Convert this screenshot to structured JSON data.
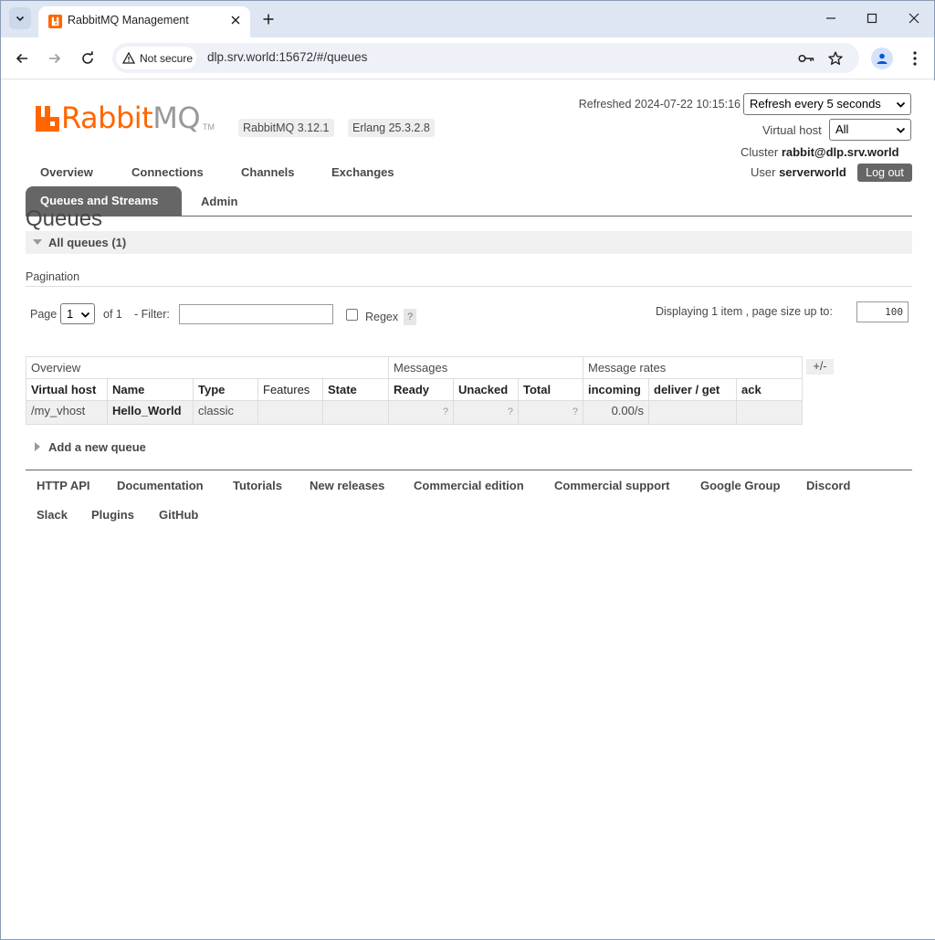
{
  "browser": {
    "tab_title": "RabbitMQ Management",
    "security_label": "Not secure",
    "url": "dlp.srv.world:15672/#/queues"
  },
  "header": {
    "logo_rabbit": "Rabbit",
    "logo_mq": "MQ",
    "logo_tm": "TM",
    "rabbitmq_version": "RabbitMQ 3.12.1",
    "erlang_version": "Erlang 25.3.2.8",
    "refreshed": "Refreshed 2024-07-22 10:15:16",
    "refresh_select": "Refresh every 5 seconds",
    "vhost_label": "Virtual host",
    "vhost_value": "All",
    "cluster_label": "Cluster",
    "cluster_value": "rabbit@dlp.srv.world",
    "user_label": "User",
    "user_value": "serverworld",
    "logout": "Log out"
  },
  "nav": {
    "overview": "Overview",
    "connections": "Connections",
    "channels": "Channels",
    "exchanges": "Exchanges",
    "queues": "Queues and Streams",
    "admin": "Admin"
  },
  "main": {
    "title": "Queues",
    "all_queues": "All queues (1)",
    "pagination_title": "Pagination",
    "page_label": "Page",
    "page_value": "1",
    "of_label": "of 1",
    "filter_label": "- Filter:",
    "regex_label": "Regex",
    "help": "?",
    "displaying": "Displaying 1 item , page size up to:",
    "page_size": "100",
    "plus_minus": "+/-",
    "add_queue": "Add a new queue"
  },
  "table": {
    "groups": [
      "Overview",
      "Messages",
      "Message rates"
    ],
    "columns": [
      "Virtual host",
      "Name",
      "Type",
      "Features",
      "State",
      "Ready",
      "Unacked",
      "Total",
      "incoming",
      "deliver / get",
      "ack"
    ],
    "rows": [
      {
        "vhost": "/my_vhost",
        "name": "Hello_World",
        "type": "classic",
        "features": "",
        "state": "",
        "ready": "?",
        "unacked": "?",
        "total": "?",
        "incoming": "0.00/s",
        "deliver": "",
        "ack": ""
      }
    ]
  },
  "footer": {
    "links": [
      "HTTP API",
      "Documentation",
      "Tutorials",
      "New releases",
      "Commercial edition",
      "Commercial support",
      "Google Group",
      "Discord",
      "Slack",
      "Plugins",
      "GitHub"
    ]
  },
  "colors": {
    "brand_orange": "#ff6600",
    "tab_active": "#666666"
  }
}
